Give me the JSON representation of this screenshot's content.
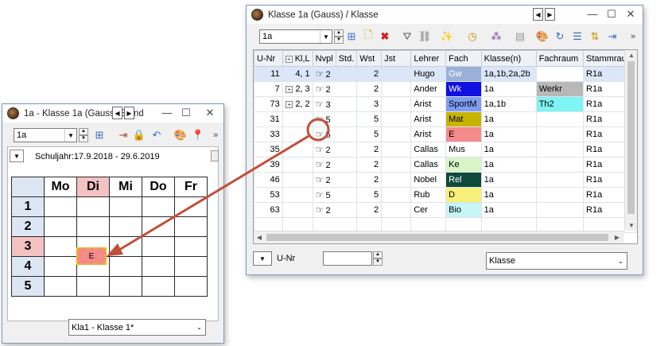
{
  "main_window": {
    "title": "Klasse 1a (Gauss) / Klasse",
    "class_selector": "1a",
    "columns": [
      "U-Nr",
      "Kl,L",
      "Nvpl",
      "Std.",
      "Wst",
      "Jst",
      "Lehrer",
      "Fach",
      "Klasse(n)",
      "Fachraum",
      "Stammraum"
    ],
    "rows": [
      {
        "unr": "11",
        "kl": "4, 1",
        "has_expander": false,
        "std": "2",
        "wst": "2",
        "jst": "",
        "lehrer": "Hugo",
        "fach": "Gw",
        "fach_bg": "#9bb0d8",
        "fach_fg": "#ffffff",
        "klasse": "1a,1b,2a,2b",
        "fachraum": "",
        "fachraum_bg": "#ffffff",
        "stammraum": "R1a"
      },
      {
        "unr": "7",
        "kl": "2, 3",
        "has_expander": true,
        "std": "2",
        "wst": "2",
        "jst": "",
        "lehrer": "Ander",
        "fach": "Wk",
        "fach_bg": "#1010e0",
        "fach_fg": "#ffffff",
        "klasse": "1a",
        "fachraum": "Werkr",
        "fachraum_bg": "#b8b8b8",
        "stammraum": "R1a"
      },
      {
        "unr": "73",
        "kl": "2, 2",
        "has_expander": true,
        "std": "3",
        "wst": "3",
        "jst": "",
        "lehrer": "Arist",
        "fach": "SportM",
        "fach_bg": "#7f9cf0",
        "fach_fg": "#000000",
        "klasse": "1a,1b",
        "fachraum": "Th2",
        "fachraum_bg": "#7ff4f4",
        "stammraum": "R1a"
      },
      {
        "unr": "31",
        "kl": "",
        "has_expander": false,
        "std": "5",
        "wst": "5",
        "jst": "",
        "lehrer": "Arist",
        "fach": "Mat",
        "fach_bg": "#c8b400",
        "fach_fg": "#000000",
        "klasse": "1a",
        "fachraum": "",
        "fachraum_bg": "#ffffff",
        "stammraum": "R1a"
      },
      {
        "unr": "33",
        "kl": "",
        "has_expander": false,
        "std": "5",
        "wst": "5",
        "jst": "",
        "lehrer": "Arist",
        "fach": "E",
        "fach_bg": "#f58a8a",
        "fach_fg": "#000000",
        "klasse": "1a",
        "fachraum": "",
        "fachraum_bg": "#ffffff",
        "stammraum": "R1a"
      },
      {
        "unr": "35",
        "kl": "",
        "has_expander": false,
        "std": "2",
        "wst": "2",
        "jst": "",
        "lehrer": "Callas",
        "fach": "Mus",
        "fach_bg": "#ffffff",
        "fach_fg": "#000000",
        "klasse": "1a",
        "fachraum": "",
        "fachraum_bg": "#ffffff",
        "stammraum": "R1a"
      },
      {
        "unr": "39",
        "kl": "",
        "has_expander": false,
        "std": "2",
        "wst": "2",
        "jst": "",
        "lehrer": "Callas",
        "fach": "Ke",
        "fach_bg": "#d8f5c8",
        "fach_fg": "#000000",
        "klasse": "1a",
        "fachraum": "",
        "fachraum_bg": "#ffffff",
        "stammraum": "R1a"
      },
      {
        "unr": "46",
        "kl": "",
        "has_expander": false,
        "std": "2",
        "wst": "2",
        "jst": "",
        "lehrer": "Nobel",
        "fach": "Rel",
        "fach_bg": "#0e4a3c",
        "fach_fg": "#ffffff",
        "klasse": "1a",
        "fachraum": "",
        "fachraum_bg": "#ffffff",
        "stammraum": "R1a"
      },
      {
        "unr": "53",
        "kl": "",
        "has_expander": false,
        "std": "5",
        "wst": "5",
        "jst": "",
        "lehrer": "Rub",
        "fach": "D",
        "fach_bg": "#f8f07a",
        "fach_fg": "#000000",
        "klasse": "1a",
        "fachraum": "",
        "fachraum_bg": "#ffffff",
        "stammraum": "R1a"
      },
      {
        "unr": "63",
        "kl": "",
        "has_expander": false,
        "std": "2",
        "wst": "2",
        "jst": "",
        "lehrer": "Cer",
        "fach": "Bio",
        "fach_bg": "#c8f5f5",
        "fach_fg": "#000000",
        "klasse": "1a",
        "fachraum": "",
        "fachraum_bg": "#ffffff",
        "stammraum": "R1a"
      }
    ],
    "footer_sort_label": "U-Nr",
    "footer_view_value": "Klasse"
  },
  "small_window": {
    "title": "1a - Klasse 1a (Gauss) Stund...",
    "class_selector": "1a",
    "schuljahr": "Schuljahr:17.9.2018 - 29.6.2019",
    "days": [
      "Mo",
      "Di",
      "Mi",
      "Do",
      "Fr"
    ],
    "periods": [
      "1",
      "2",
      "3",
      "4",
      "5"
    ],
    "lesson_label": "E",
    "layout_value": "Kla1 - Klasse 1*"
  },
  "colors": {
    "highlight_pink": "#f4c2c2",
    "arrow": "#c0503a",
    "lesson_e": "#f58a8a"
  }
}
